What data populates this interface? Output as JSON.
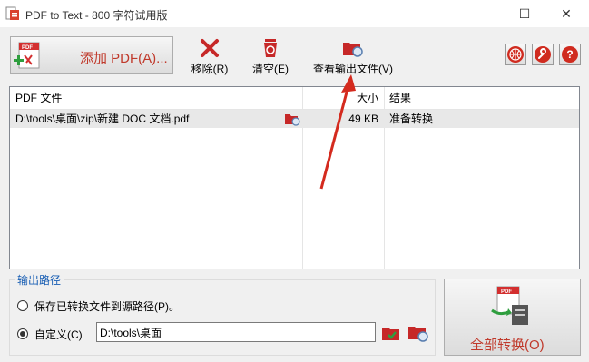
{
  "window": {
    "title": "PDF to Text - 800 字符试用版",
    "minimize": "—",
    "maximize": "☐",
    "close": "✕"
  },
  "toolbar": {
    "add_pdf_label": "添加 PDF(A)...",
    "remove_label": "移除(R)",
    "clear_label": "清空(E)",
    "view_output_label": "查看输出文件(V)",
    "help_buttons": [
      "globe-icon",
      "wrench-icon",
      "question-icon"
    ],
    "question_glyph": "?"
  },
  "file_list": {
    "columns": [
      "PDF 文件",
      "大小",
      "结果"
    ],
    "rows": [
      {
        "file": "D:\\tools\\桌面\\zip\\新建 DOC 文档.pdf",
        "size": "49 KB",
        "result": "准备转换"
      }
    ]
  },
  "output": {
    "group_title": "输出路径",
    "option_source": "保存已转换文件到源路径(P)。",
    "option_custom": "自定义(C)",
    "selected": "custom",
    "custom_path": "D:\\tools\\桌面"
  },
  "convert_all_label": "全部转换(O)",
  "colors": {
    "accent_red": "#c0392b",
    "group_title": "#1a5fb4",
    "annotation_arrow": "#d42a1e"
  }
}
